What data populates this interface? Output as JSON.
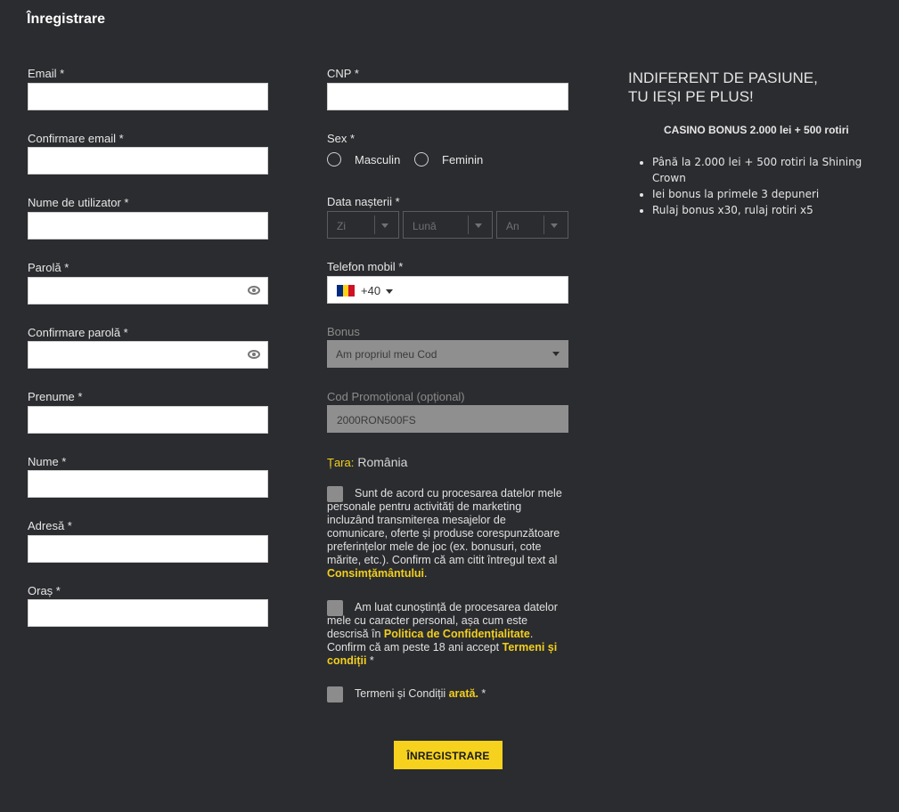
{
  "title": "Înregistrare",
  "left_fields": [
    {
      "label": "Email *",
      "has_eye": false
    },
    {
      "label": "Confirmare email *",
      "has_eye": false
    },
    {
      "label": "Nume de utilizator *",
      "has_eye": false
    },
    {
      "label": "Parolă *",
      "has_eye": true
    },
    {
      "label": "Confirmare parolă *",
      "has_eye": true
    },
    {
      "label": "Prenume *",
      "has_eye": false
    },
    {
      "label": "Nume *",
      "has_eye": false
    },
    {
      "label": "Adresă *",
      "has_eye": false
    },
    {
      "label": "Oraș *",
      "has_eye": false
    }
  ],
  "cnp": {
    "label": "CNP *"
  },
  "sex": {
    "label": "Sex *",
    "options": [
      "Masculin",
      "Feminin"
    ]
  },
  "birthdate": {
    "label": "Data nașterii *",
    "day": "Zi",
    "month": "Lună",
    "year": "An"
  },
  "phone": {
    "label": "Telefon mobil *",
    "code": "+40",
    "flag_colors": [
      "#002b7f",
      "#fcd116",
      "#ce1126"
    ]
  },
  "bonus": {
    "label": "Bonus",
    "value": "Am propriul meu Cod"
  },
  "promo_code": {
    "label": "Cod Promoțional (opțional)",
    "value": "2000RON500FS"
  },
  "country": {
    "label": "Țara:",
    "value": "România"
  },
  "consents": {
    "marketing": {
      "text": "Sunt de acord cu procesarea datelor mele personale pentru activități de marketing incluzând transmiterea mesajelor de comunicare, oferte și produse corespunzătoare preferințelor mele de joc (ex. bonusuri, cote mărite, etc.). Confirm că am citit întregul text al ",
      "link": "Consimțământului",
      "suffix": "."
    },
    "privacy": {
      "text": "Am luat cunoștință de procesarea datelor mele cu caracter personal, așa cum este descrisă în ",
      "link1": "Politica de Confidențialitate",
      "mid": ". Confirm că am peste 18 ani accept ",
      "link2": "Termeni și condiții",
      "suffix": " *"
    },
    "terms": {
      "text": "Termeni și Condiții ",
      "link": "arată.",
      "suffix": " *"
    }
  },
  "submit_label": "ÎNREGISTRARE",
  "promo": {
    "title_line1": "INDIFERENT DE PASIUNE,",
    "title_line2": "TU IEȘI PE PLUS!",
    "subtitle": "CASINO BONUS 2.000 lei + 500 rotiri",
    "bullets": [
      "Până la 2.000 lei + 500 rotiri la Shining Crown",
      "Iei bonus la primele 3 depuneri",
      "Rulaj bonus x30, rulaj rotiri x5"
    ]
  },
  "colors": {
    "background": "#2b2c2f",
    "accent": "#f6d21e",
    "input_disabled": "#8f8f8f"
  }
}
